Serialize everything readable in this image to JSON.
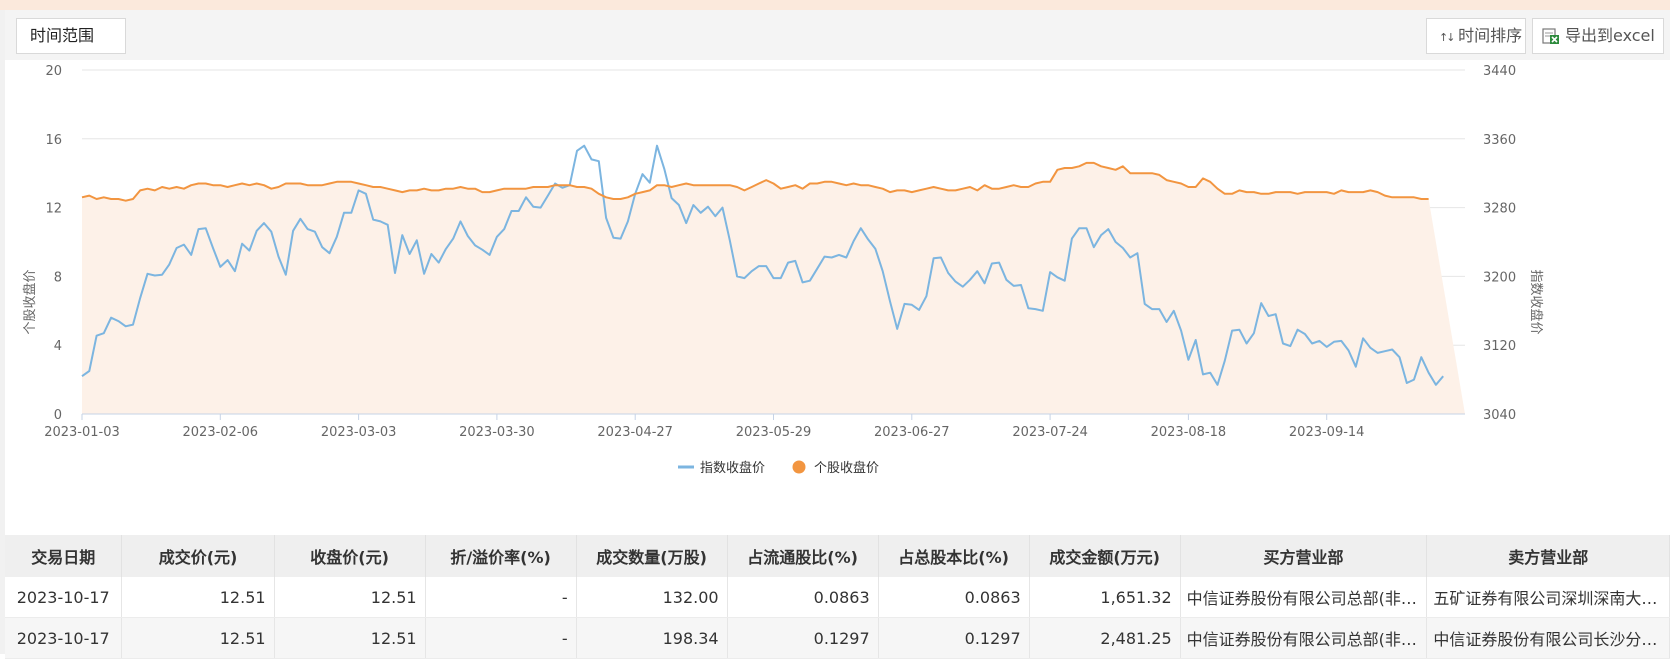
{
  "toolbar": {
    "range_label": "时间范围",
    "sort_label": "时间排序",
    "export_label": "导出到excel",
    "sort_icon": "sort-up-down-arrows-icon",
    "export_icon": "excel-icon"
  },
  "colors": {
    "index_line": "#7cb5e0",
    "stock_line": "#f29540",
    "stock_area": "#fdf1e8",
    "accent_bar": "#fbe9dc"
  },
  "chart_data": {
    "type": "line",
    "legend_position": "bottom-center",
    "grid": true,
    "y_left": {
      "label": "个股收盘价",
      "ylim": [
        0,
        20
      ],
      "ticks": [
        "0",
        "4",
        "8",
        "12",
        "16",
        "20"
      ]
    },
    "y_right": {
      "label": "指数收盘价",
      "ylim": [
        3040,
        3440
      ],
      "ticks": [
        "3040",
        "3120",
        "3200",
        "3280",
        "3360",
        "3440"
      ]
    },
    "x_tick_labels": [
      "2023-01-03",
      "2023-02-06",
      "2023-03-03",
      "2023-03-30",
      "2023-04-27",
      "2023-05-29",
      "2023-06-27",
      "2023-07-24",
      "2023-08-18",
      "2023-09-14"
    ],
    "point_count": 191,
    "series": [
      {
        "name": "指数收盘价",
        "axis": "right",
        "values": [
          3084,
          3090,
          3131,
          3134,
          3152,
          3148,
          3142,
          3144,
          3175,
          3203,
          3201,
          3202,
          3214,
          3233,
          3237,
          3225,
          3255,
          3256,
          3233,
          3211,
          3219,
          3206,
          3238,
          3230,
          3253,
          3262,
          3252,
          3223,
          3202,
          3253,
          3267,
          3255,
          3252,
          3234,
          3227,
          3246,
          3274,
          3274,
          3300,
          3296,
          3266,
          3264,
          3260,
          3204,
          3248,
          3226,
          3242,
          3203,
          3226,
          3216,
          3232,
          3244,
          3264,
          3247,
          3236,
          3231,
          3225,
          3246,
          3255,
          3276,
          3276,
          3292,
          3281,
          3280,
          3294,
          3308,
          3303,
          3306,
          3346,
          3352,
          3336,
          3334,
          3268,
          3245,
          3244,
          3264,
          3296,
          3319,
          3309,
          3352,
          3325,
          3291,
          3283,
          3262,
          3283,
          3274,
          3281,
          3270,
          3280,
          3242,
          3200,
          3198,
          3206,
          3212,
          3212,
          3198,
          3198,
          3216,
          3218,
          3193,
          3195,
          3209,
          3223,
          3222,
          3225,
          3222,
          3241,
          3256,
          3243,
          3232,
          3206,
          3171,
          3139,
          3168,
          3167,
          3161,
          3177,
          3221,
          3222,
          3204,
          3194,
          3188,
          3196,
          3206,
          3192,
          3215,
          3216,
          3196,
          3189,
          3190,
          3163,
          3162,
          3160,
          3205,
          3199,
          3195,
          3244,
          3256,
          3256,
          3234,
          3248,
          3255,
          3240,
          3233,
          3222,
          3227,
          3168,
          3162,
          3162,
          3147,
          3160,
          3137,
          3103,
          3126,
          3086,
          3088,
          3074,
          3102,
          3137,
          3138,
          3122,
          3134,
          3169,
          3154,
          3156,
          3122,
          3119,
          3138,
          3133,
          3122,
          3125,
          3118,
          3124,
          3125,
          3114,
          3095,
          3128,
          3117,
          3111,
          3113,
          3115,
          3106,
          3076,
          3080,
          3106,
          3088,
          3074,
          3084
        ]
      },
      {
        "name": "个股收盘价",
        "axis": "left",
        "values": [
          12.6,
          12.7,
          12.5,
          12.6,
          12.5,
          12.5,
          12.4,
          12.5,
          13.0,
          13.1,
          13.0,
          13.2,
          13.1,
          13.2,
          13.1,
          13.3,
          13.4,
          13.4,
          13.3,
          13.3,
          13.2,
          13.3,
          13.4,
          13.3,
          13.4,
          13.3,
          13.1,
          13.2,
          13.4,
          13.4,
          13.4,
          13.3,
          13.3,
          13.3,
          13.4,
          13.5,
          13.5,
          13.5,
          13.4,
          13.3,
          13.2,
          13.2,
          13.1,
          13.0,
          12.9,
          13.0,
          13.0,
          13.1,
          13.0,
          13.0,
          13.1,
          13.1,
          13.2,
          13.1,
          13.1,
          12.9,
          12.9,
          13.0,
          13.1,
          13.1,
          13.1,
          13.1,
          13.2,
          13.2,
          13.2,
          13.3,
          13.3,
          13.3,
          13.2,
          13.2,
          13.1,
          12.8,
          12.6,
          12.5,
          12.5,
          12.6,
          12.8,
          12.9,
          13.0,
          13.3,
          13.3,
          13.2,
          13.3,
          13.4,
          13.3,
          13.3,
          13.3,
          13.3,
          13.3,
          13.3,
          13.2,
          13.0,
          13.2,
          13.4,
          13.6,
          13.4,
          13.1,
          13.2,
          13.3,
          13.1,
          13.4,
          13.4,
          13.5,
          13.5,
          13.4,
          13.3,
          13.4,
          13.3,
          13.3,
          13.2,
          13.1,
          12.9,
          13.0,
          13.0,
          12.9,
          13.0,
          13.1,
          13.2,
          13.1,
          13.0,
          13.0,
          13.1,
          13.2,
          13.0,
          13.3,
          13.1,
          13.1,
          13.2,
          13.3,
          13.2,
          13.2,
          13.4,
          13.5,
          13.5,
          14.2,
          14.3,
          14.3,
          14.4,
          14.6,
          14.6,
          14.4,
          14.3,
          14.2,
          14.4,
          14.0,
          14.0,
          14.0,
          14.0,
          13.9,
          13.6,
          13.5,
          13.4,
          13.2,
          13.2,
          13.7,
          13.5,
          13.1,
          12.8,
          12.8,
          13.0,
          12.9,
          12.9,
          12.8,
          12.8,
          12.9,
          12.9,
          12.9,
          12.8,
          12.9,
          12.9,
          12.9,
          12.9,
          12.8,
          13.0,
          12.9,
          12.9,
          12.9,
          13.0,
          12.9,
          12.7,
          12.6,
          12.6,
          12.6,
          12.6,
          12.5,
          12.5
        ]
      }
    ]
  },
  "table": {
    "headers": [
      "交易日期",
      "成交价(元)",
      "收盘价(元)",
      "折/溢价率(%)",
      "成交数量(万股)",
      "占流通股比(%)",
      "占总股本比(%)",
      "成交金额(万元)",
      "买方营业部",
      "卖方营业部"
    ],
    "rows": [
      [
        "2023-10-17",
        "12.51",
        "12.51",
        "-",
        "132.00",
        "0.0863",
        "0.0863",
        "1,651.32",
        "中信证券股份有限公司总部(非营业场所)",
        "五矿证券有限公司深圳深南大道证券营业部"
      ],
      [
        "2023-10-17",
        "12.51",
        "12.51",
        "-",
        "198.34",
        "0.1297",
        "0.1297",
        "2,481.25",
        "中信证券股份有限公司总部(非营业场所)",
        "中信证券股份有限公司长沙分公司营业部"
      ]
    ]
  }
}
